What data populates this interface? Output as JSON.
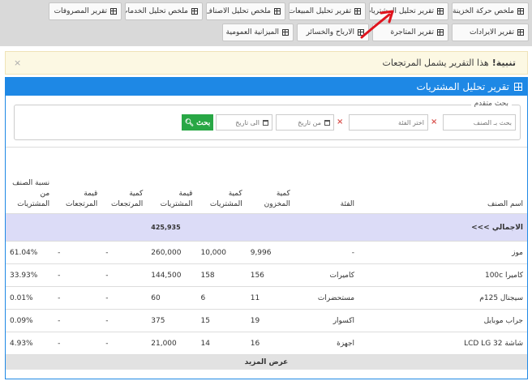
{
  "tabs": [
    {
      "label": "ملخص حركة الخزينة"
    },
    {
      "label": "تقرير تحليل المشتريات"
    },
    {
      "label": "تقرير تحليل المبيعات"
    },
    {
      "label": "ملخص تحليل الاصناف"
    },
    {
      "label": "ملخص تحليل الخدمات"
    },
    {
      "label": "تقرير المصروفات"
    },
    {
      "label": "تقرير الايرادات"
    },
    {
      "label": "تقرير المتاجرة"
    },
    {
      "label": "الارباح والخسائر"
    },
    {
      "label": "الميزانية العمومية"
    }
  ],
  "alert": {
    "strong": "تنبية!",
    "text": "هذا التقرير يشمل المرتجعات",
    "close": "×"
  },
  "panel": {
    "title": "تقرير تحليل المشتريات"
  },
  "search": {
    "legend": "بحث متقدم",
    "item_placeholder": "بحث بـ الصنف",
    "category_placeholder": "اختر الفئة",
    "from_date": "من تاريخ",
    "to_date": "الى تاريخ",
    "button": "بحث",
    "clear": "×"
  },
  "table": {
    "headers": [
      "اسم الصنف",
      "الفئة",
      "كمية المخزون",
      "كمية المشتريات",
      "قيمة المشتريات",
      "كمية المرتجعات",
      "قيمة المرتجعات",
      "نسبة الصنف من المشتريات"
    ],
    "total": {
      "label": "الاجمالي >>>",
      "purchase_value": "425,935"
    },
    "rows": [
      {
        "name": "موز",
        "category": "-",
        "stock": "9,996",
        "qty": "10,000",
        "value": "260,000",
        "ret_qty": "-",
        "ret_value": "-",
        "pct": "61.04%"
      },
      {
        "name": "كاميرا 100c",
        "category": "كاميرات",
        "stock": "156",
        "qty": "158",
        "value": "144,500",
        "ret_qty": "-",
        "ret_value": "-",
        "pct": "33.93%"
      },
      {
        "name": "سيجنال 125م",
        "category": "مستحضرات",
        "stock": "11",
        "qty": "6",
        "value": "60",
        "ret_qty": "-",
        "ret_value": "-",
        "pct": "0.01%"
      },
      {
        "name": "جراب موبايل",
        "category": "اكسوار",
        "stock": "19",
        "qty": "15",
        "value": "375",
        "ret_qty": "-",
        "ret_value": "-",
        "pct": "0.09%"
      },
      {
        "name": "شاشة LCD LG 32",
        "category": "اجهزة",
        "stock": "16",
        "qty": "14",
        "value": "21,000",
        "ret_qty": "-",
        "ret_value": "-",
        "pct": "4.93%"
      }
    ],
    "show_more": "عرض المزيد"
  }
}
